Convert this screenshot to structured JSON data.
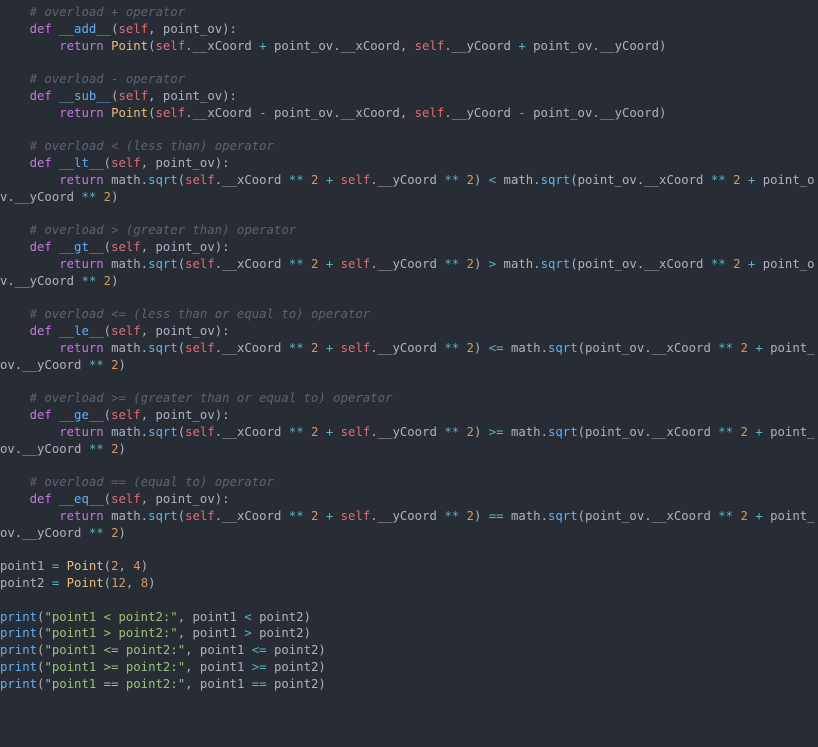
{
  "code": {
    "methods": [
      {
        "comment": "# overload + operator",
        "name": "__add__",
        "param": "point_ov",
        "ret": "return Point(self.__xCoord + point_ov.__xCoord, self.__yCoord + point_ov.__yCoord)"
      },
      {
        "comment": "# overload - operator",
        "name": "__sub__",
        "param": "point_ov",
        "ret": "return Point(self.__xCoord - point_ov.__xCoord, self.__yCoord - point_ov.__yCoord)"
      },
      {
        "comment": "# overload < (less than) operator",
        "name": "__lt__",
        "param": "point_ov",
        "cmp": "<"
      },
      {
        "comment": "# overload > (greater than) operator",
        "name": "__gt__",
        "param": "point_ov",
        "cmp": ">"
      },
      {
        "comment": "# overload <= (less than or equal to) operator",
        "name": "__le__",
        "param": "point_ov",
        "cmp": "<="
      },
      {
        "comment": "# overload >= (greater than or equal to) operator",
        "name": "__ge__",
        "param": "point_ov",
        "cmp": ">="
      },
      {
        "comment": "# overload == (equal to) operator",
        "name": "__eq__",
        "param": "point_ov",
        "cmp": "=="
      }
    ],
    "assignments": [
      {
        "var": "point1",
        "x": "2",
        "y": "4"
      },
      {
        "var": "point2",
        "x": "12",
        "y": "8"
      }
    ],
    "prints": [
      {
        "label": "\"point1 < point2:\"",
        "expr_lhs": "point1",
        "op": "<",
        "expr_rhs": "point2"
      },
      {
        "label": "\"point1 > point2:\"",
        "expr_lhs": "point1",
        "op": ">",
        "expr_rhs": "point2"
      },
      {
        "label": "\"point1 <= point2:\"",
        "expr_lhs": "point1",
        "op": "<=",
        "expr_rhs": "point2"
      },
      {
        "label": "\"point1 >= point2:\"",
        "expr_lhs": "point1",
        "op": ">=",
        "expr_rhs": "point2"
      },
      {
        "label": "\"point1 == point2:\"",
        "expr_lhs": "point1",
        "op": "==",
        "expr_rhs": "point2"
      }
    ],
    "numbers": {
      "two": "2"
    },
    "tokens": {
      "def": "def",
      "return": "return",
      "self": "self",
      "Point": "Point",
      "print": "print",
      "math_sqrt": "math.sqrt"
    }
  }
}
